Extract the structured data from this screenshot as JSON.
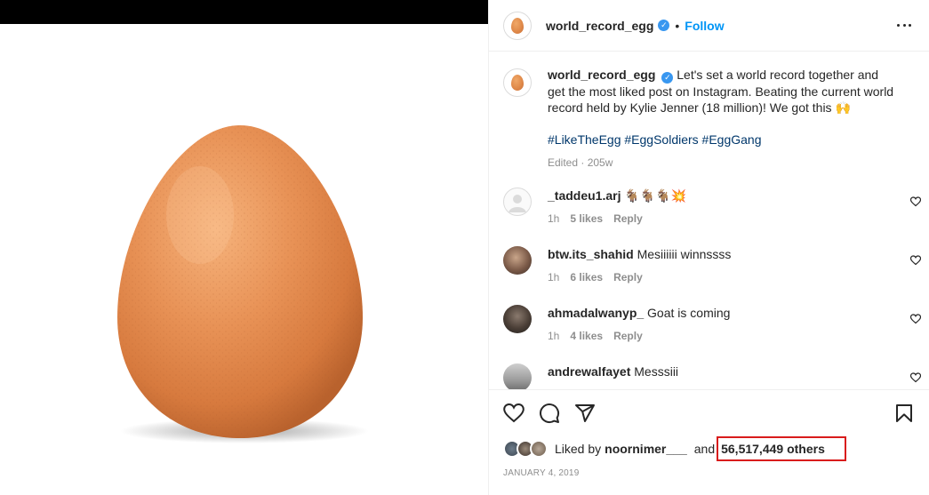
{
  "post": {
    "username": "world_record_egg",
    "verified_mark": "✓",
    "separator": "•",
    "follow_label": "Follow"
  },
  "caption": {
    "username": "world_record_egg",
    "text": "Let's set a world record together and get the most liked post on Instagram. Beating the current world record held by Kylie Jenner (18 million)! We got this",
    "emoji": "🙌",
    "hashtags": "#LikeTheEgg #EggSoldiers #EggGang",
    "edited": "Edited · 205w"
  },
  "comments": [
    {
      "username": "_taddeu1.arj",
      "text": "🐐🐐🐐💥",
      "time": "1h",
      "likes": "5 likes",
      "reply": "Reply"
    },
    {
      "username": "btw.its_shahid",
      "text": "Mesiiiiii winnssss",
      "time": "1h",
      "likes": "6 likes",
      "reply": "Reply"
    },
    {
      "username": "ahmadalwanyp_",
      "text": "Goat is coming",
      "time": "1h",
      "likes": "4 likes",
      "reply": "Reply"
    },
    {
      "username": "andrewalfayet",
      "text": "Messsiii",
      "time": "",
      "likes": "",
      "reply": ""
    }
  ],
  "likes": {
    "liked_by": "Liked by",
    "user": "noornimer___",
    "and": "and",
    "others": "56,517,449 others"
  },
  "date": "JANUARY 4, 2019",
  "colors": {
    "accent": "#0095f6",
    "hashtag": "#00376b",
    "highlight": "#d91c1c",
    "egg": "#e08a4a"
  },
  "icons": [
    "more-options-icon",
    "heart-icon",
    "comment-icon",
    "share-icon",
    "bookmark-icon",
    "verified-badge-icon"
  ]
}
